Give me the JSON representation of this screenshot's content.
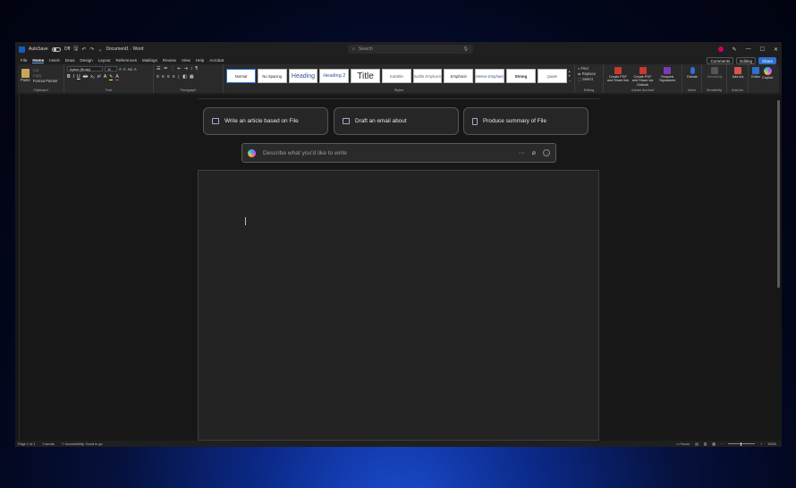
{
  "titlebar": {
    "autosave": "AutoSave",
    "autosave_state": "Off",
    "doc_title": "Document1 · Word",
    "search_placeholder": "Search",
    "minimize": "—",
    "maximize": "☐",
    "close": "✕"
  },
  "menu": {
    "tabs": [
      "File",
      "Home",
      "Insert",
      "Draw",
      "Design",
      "Layout",
      "References",
      "Mailings",
      "Review",
      "View",
      "Help",
      "Acrobat"
    ],
    "active_tab": "Home",
    "comments": "Comments",
    "editing": "Editing",
    "share": "Share"
  },
  "ribbon": {
    "clipboard": {
      "paste": "Paste",
      "cut": "Cut",
      "copy": "Copy",
      "format_painter": "Format Painter",
      "label": "Clipboard"
    },
    "font": {
      "family": "Aptos (Body)",
      "size": "11",
      "label": "Font"
    },
    "paragraph": {
      "label": "Paragraph"
    },
    "styles": {
      "items": [
        "Normal",
        "No Spacing",
        "Heading",
        "Heading 2",
        "Title",
        "Subtitle",
        "Subtle Emphasis",
        "Emphasis",
        "Intense Emphasis",
        "Strong",
        "Quote"
      ],
      "label": "Styles"
    },
    "editing": {
      "find": "Find",
      "replace": "Replace",
      "select": "Select",
      "label": "Editing"
    },
    "acrobat": {
      "create_pdf_share": "Create PDF and Share link",
      "create_pdf_outlook": "Create PDF and Share via Outlook",
      "request_signatures": "Request Signatures",
      "label": "Adobe Acrobat"
    },
    "voice": {
      "dictate": "Dictate",
      "label": "Voice"
    },
    "sensitivity": {
      "button": "Sensitivity",
      "label": "Sensitivity"
    },
    "addins": {
      "button": "Add-ins",
      "label": "Add-ins"
    },
    "editor": "Editor",
    "copilot": "Copilot"
  },
  "copilot": {
    "suggestions": [
      "Write an article based on File",
      "Draft an email about",
      "Produce summary of File"
    ],
    "prompt_placeholder": "Describe what you'd like to write"
  },
  "status": {
    "page": "Page 1 of 1",
    "words": "0 words",
    "accessibility": "Accessibility: Good to go",
    "focus": "Focus",
    "zoom": "100%"
  }
}
